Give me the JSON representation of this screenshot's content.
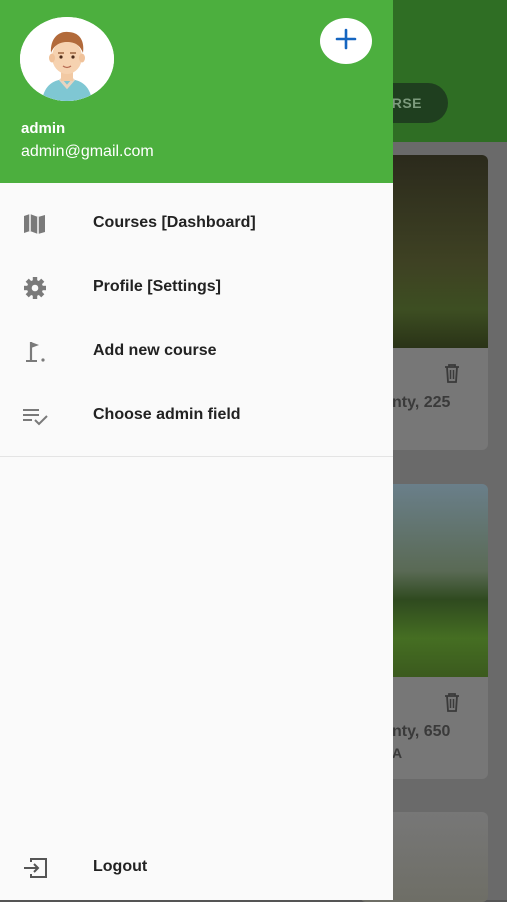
{
  "background": {
    "action_button_label": "RSE",
    "cards": [
      {
        "location_text": "nty, 225",
        "extra_text": ""
      },
      {
        "location_text": "nty, 650",
        "extra_text": "A"
      },
      {
        "location_text": "",
        "extra_text": ""
      }
    ]
  },
  "drawer": {
    "header": {
      "user_name": "admin",
      "user_email": "admin@gmail.com",
      "add_icon": "plus-icon"
    },
    "menu": [
      {
        "label": "Courses [Dashboard]",
        "icon": "map-icon"
      },
      {
        "label": "Profile [Settings]",
        "icon": "gear-icon"
      },
      {
        "label": "Add new course",
        "icon": "golf-flag-icon"
      },
      {
        "label": "Choose admin field",
        "icon": "checklist-icon"
      }
    ],
    "logout": {
      "label": "Logout",
      "icon": "logout-icon"
    }
  },
  "colors": {
    "drawer_header": "#4caf3e",
    "accent_blue": "#1565c0"
  }
}
